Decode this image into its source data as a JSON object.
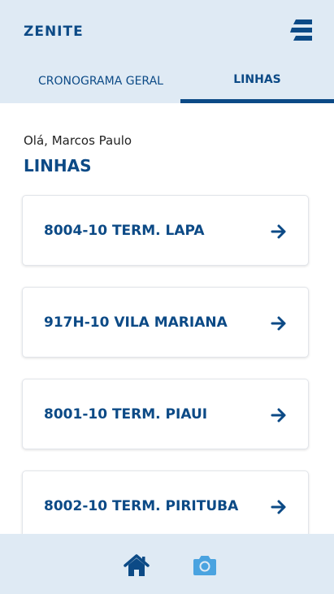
{
  "app": {
    "brand": "ZENITE"
  },
  "tabs": [
    {
      "label": "CRONOGRAMA GERAL",
      "active": false
    },
    {
      "label": "LINHAS",
      "active": true
    }
  ],
  "main": {
    "greeting": "Olá, Marcos Paulo",
    "title": "LINHAS",
    "lines": [
      {
        "label": "8004-10 TERM. LAPA"
      },
      {
        "label": "917H-10 VILA MARIANA"
      },
      {
        "label": "8001-10 TERM. PIAUI"
      },
      {
        "label": "8002-10 TERM. PIRITUBA"
      }
    ]
  },
  "bottom_nav": [
    {
      "icon": "home-icon",
      "active": true
    },
    {
      "icon": "camera-icon",
      "active": false
    }
  ],
  "colors": {
    "primary": "#0c4a86",
    "header_bg": "#dfeaf4",
    "accent_light": "#4aa3e0"
  }
}
